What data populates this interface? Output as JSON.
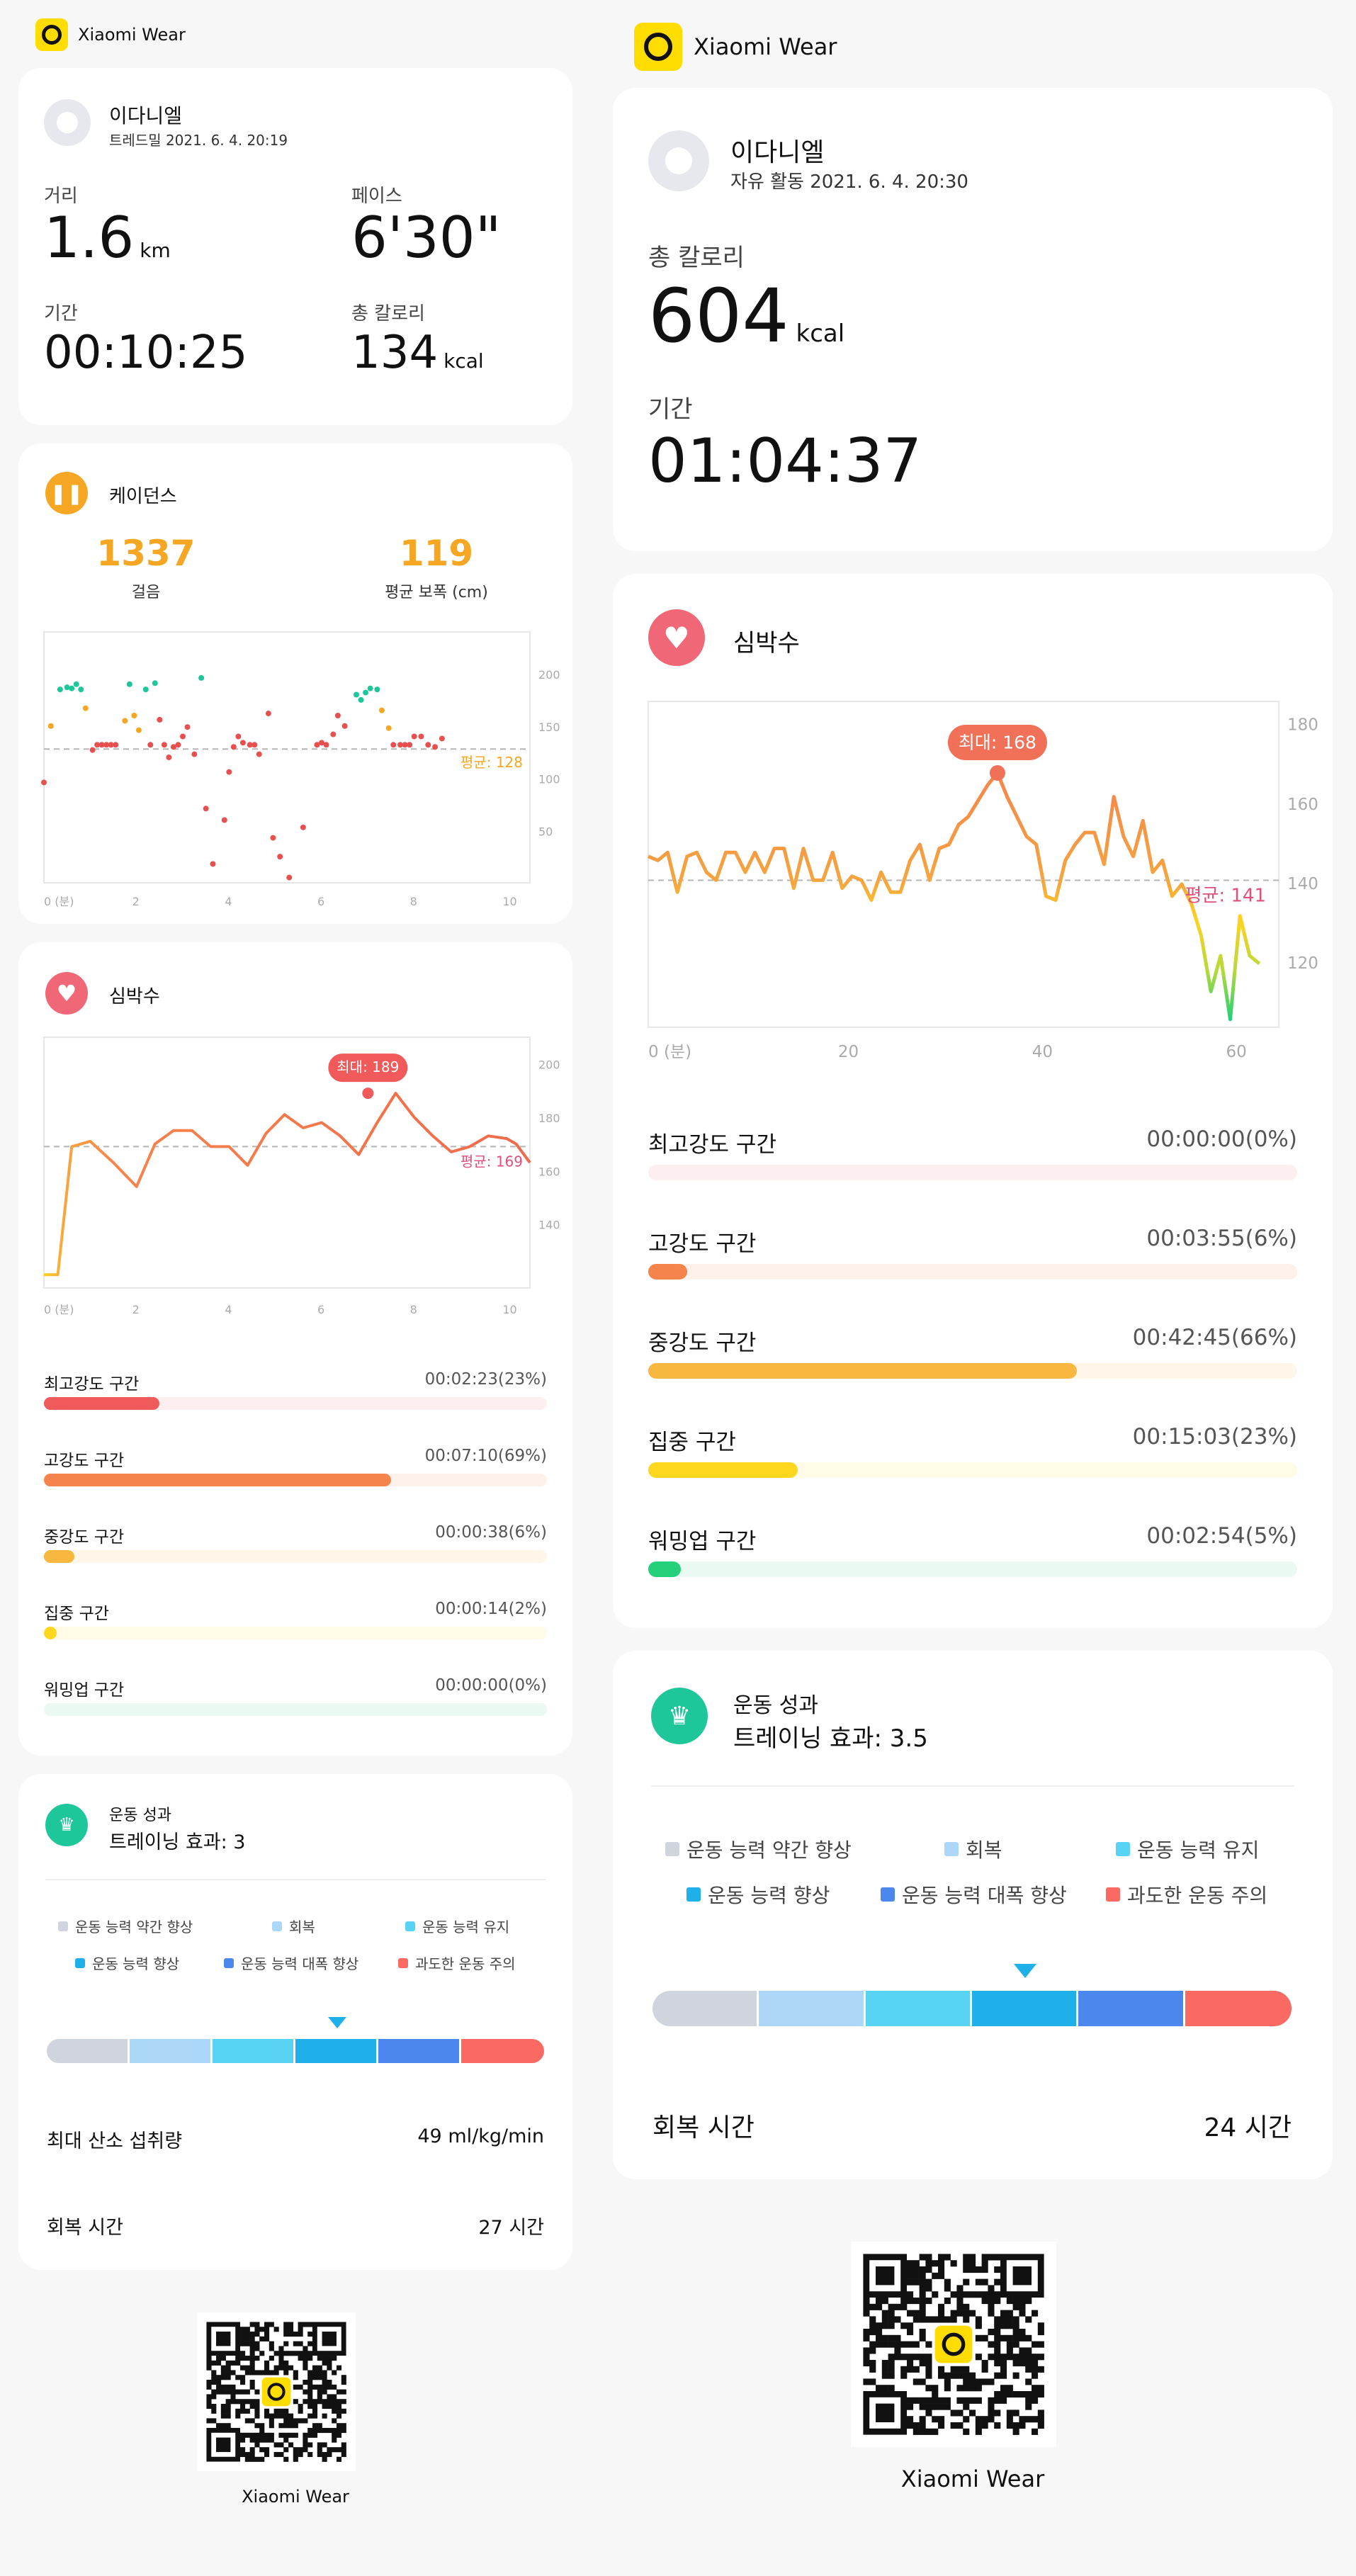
{
  "brand": {
    "name": "Xiaomi Wear"
  },
  "colors": {
    "zone_peak": "#f05a5a",
    "zone_anaerobic": "#f5844c",
    "zone_aerobic": "#f8b73e",
    "zone_fatburn": "#ffd71f",
    "zone_warmup": "#25d07a",
    "perf1": "#d0d5dd",
    "perf2": "#acd7f8",
    "perf3": "#58d3f4",
    "perf4": "#1fb0ea",
    "perf5": "#4b87ec",
    "perf6": "#fb6a62",
    "cadence": "#f5a623",
    "heart": "#f06878",
    "trophy": "#1ec79a"
  },
  "left": {
    "workout": {
      "user_name": "이다니엘",
      "subtitle": "트레드밀 2021. 6. 4. 20:19",
      "stats": [
        {
          "label": "거리",
          "value": "1.6",
          "unit": "km"
        },
        {
          "label": "페이스",
          "value": "6'30\"",
          "unit": ""
        },
        {
          "label": "기간",
          "value": "00:10:25",
          "unit": ""
        },
        {
          "label": "총 칼로리",
          "value": "134",
          "unit": "kcal"
        }
      ]
    },
    "cadence": {
      "title": "케이던스",
      "steps_value": "1337",
      "steps_label": "걸음",
      "stride_value": "119",
      "stride_label": "평균 보폭 (cm)",
      "avg_label": "평균: 128"
    },
    "heart": {
      "title": "심박수",
      "max_label": "최대: 189",
      "avg_label": "평균: 169"
    },
    "zones": [
      {
        "name": "최고강도 구간",
        "time": "00:02:23(23%)",
        "pct": 23,
        "color": "#f05a5a",
        "track": "#fdefef"
      },
      {
        "name": "고강도 구간",
        "time": "00:07:10(69%)",
        "pct": 69,
        "color": "#f5844c",
        "track": "#fef1ea"
      },
      {
        "name": "중강도 구간",
        "time": "00:00:38(6%)",
        "pct": 6,
        "color": "#f8b73e",
        "track": "#fef6e8"
      },
      {
        "name": "집중 구간",
        "time": "00:00:14(2%)",
        "pct": 2,
        "color": "#ffd71f",
        "track": "#fffbe6"
      },
      {
        "name": "워밍업 구간",
        "time": "00:00:00(0%)",
        "pct": 0,
        "color": "#25d07a",
        "track": "#eaf9f1"
      }
    ],
    "performance": {
      "title": "운동 성과",
      "effect": "트레이닝 효과: 3",
      "legend": [
        "운동 능력 약간 향상",
        "회복",
        "운동 능력 유지",
        "운동 능력 향상",
        "운동 능력 대폭 향상",
        "과도한 운동 주의"
      ],
      "level": 3.5,
      "vo2_label": "최대 산소 섭취량",
      "vo2_value": "49 ml/kg/min",
      "recovery_label": "회복 시간",
      "recovery_value": "27 시간"
    }
  },
  "right": {
    "workout": {
      "user_name": "이다니엘",
      "subtitle": "자유 활동 2021. 6. 4. 20:30",
      "calories_label": "총 칼로리",
      "calories_value": "604",
      "calories_unit": "kcal",
      "duration_label": "기간",
      "duration_value": "01:04:37"
    },
    "heart": {
      "title": "심박수",
      "max_label": "최대: 168",
      "avg_label": "평균: 141"
    },
    "zones": [
      {
        "name": "최고강도 구간",
        "time": "00:00:00(0%)",
        "pct": 0,
        "color": "#f05a5a",
        "track": "#fdefef"
      },
      {
        "name": "고강도 구간",
        "time": "00:03:55(6%)",
        "pct": 6,
        "color": "#f5844c",
        "track": "#fef1ea"
      },
      {
        "name": "중강도 구간",
        "time": "00:42:45(66%)",
        "pct": 66,
        "color": "#f8b73e",
        "track": "#fef6e8"
      },
      {
        "name": "집중 구간",
        "time": "00:15:03(23%)",
        "pct": 23,
        "color": "#ffd71f",
        "track": "#fffbe6"
      },
      {
        "name": "워밍업 구간",
        "time": "00:02:54(5%)",
        "pct": 5,
        "color": "#25d07a",
        "track": "#eaf9f1"
      }
    ],
    "performance": {
      "title": "운동 성과",
      "effect": "트레이닝 효과: 3.5",
      "legend": [
        "운동 능력 약간 향상",
        "회복",
        "운동 능력 유지",
        "운동 능력 향상",
        "운동 능력 대폭 향상",
        "과도한 운동 주의"
      ],
      "level": 3.5,
      "recovery_label": "회복 시간",
      "recovery_value": "24 시간"
    }
  },
  "chart_data": [
    {
      "type": "scatter",
      "title": "케이던스",
      "xlabel": "(분)",
      "x_ticks": [
        "0 (분)",
        "2",
        "4",
        "6",
        "8",
        "10"
      ],
      "y_ticks": [
        "200",
        "150",
        "100",
        "50"
      ],
      "xlim": [
        0,
        10.5
      ],
      "ylim": [
        0,
        240
      ],
      "average": 128,
      "series": [
        {
          "values": [
            [
              0,
              96
            ],
            [
              0.15,
              150
            ],
            [
              0.35,
              185
            ],
            [
              0.5,
              187
            ],
            [
              0.6,
              186
            ],
            [
              0.7,
              190
            ],
            [
              0.8,
              185
            ],
            [
              0.9,
              167
            ],
            [
              1.05,
              127
            ],
            [
              1.15,
              132
            ],
            [
              1.25,
              132
            ],
            [
              1.35,
              132
            ],
            [
              1.45,
              132
            ],
            [
              1.55,
              132
            ],
            [
              1.75,
              155
            ],
            [
              1.85,
              190
            ],
            [
              1.95,
              160
            ],
            [
              2.05,
              146
            ],
            [
              2.2,
              185
            ],
            [
              2.3,
              132
            ],
            [
              2.4,
              191
            ],
            [
              2.5,
              156
            ],
            [
              2.6,
              132
            ],
            [
              2.7,
              120
            ],
            [
              2.8,
              130
            ],
            [
              2.9,
              132
            ],
            [
              3.0,
              140
            ],
            [
              3.1,
              149
            ],
            [
              3.25,
              123
            ],
            [
              3.4,
              196
            ],
            [
              3.5,
              71
            ],
            [
              3.65,
              18
            ],
            [
              3.9,
              60
            ],
            [
              4.0,
              106
            ],
            [
              4.1,
              130
            ],
            [
              4.2,
              140
            ],
            [
              4.3,
              134
            ],
            [
              4.45,
              132
            ],
            [
              4.55,
              132
            ],
            [
              4.65,
              123
            ],
            [
              4.85,
              162
            ],
            [
              4.95,
              43
            ],
            [
              5.1,
              25
            ],
            [
              5.3,
              5
            ],
            [
              5.6,
              53
            ],
            [
              5.9,
              132
            ],
            [
              6.0,
              134
            ],
            [
              6.1,
              132
            ],
            [
              6.25,
              142
            ],
            [
              6.35,
              160
            ],
            [
              6.5,
              150
            ],
            [
              6.75,
              180
            ],
            [
              6.85,
              175
            ],
            [
              6.95,
              182
            ],
            [
              7.05,
              186
            ],
            [
              7.2,
              185
            ],
            [
              7.3,
              165
            ],
            [
              7.45,
              148
            ],
            [
              7.55,
              132
            ],
            [
              7.7,
              132
            ],
            [
              7.8,
              132
            ],
            [
              7.9,
              132
            ],
            [
              8.0,
              140
            ],
            [
              8.15,
              140
            ],
            [
              8.3,
              132
            ],
            [
              8.45,
              130
            ],
            [
              8.6,
              138
            ]
          ]
        }
      ]
    },
    {
      "type": "line",
      "title": "심박수",
      "xlabel": "(분)",
      "x_ticks": [
        "0 (분)",
        "2",
        "4",
        "6",
        "8",
        "10"
      ],
      "y_ticks": [
        "200",
        "180",
        "160",
        "140"
      ],
      "xlim": [
        0,
        10.5
      ],
      "ylim": [
        116,
        210
      ],
      "average": 169,
      "max_point": [
        7,
        189
      ],
      "series": [
        {
          "values": [
            [
              0,
              121
            ],
            [
              0.3,
              121
            ],
            [
              0.6,
              169
            ],
            [
              1.0,
              171
            ],
            [
              1.5,
              163
            ],
            [
              2.0,
              154
            ],
            [
              2.4,
              170
            ],
            [
              2.8,
              175
            ],
            [
              3.2,
              175
            ],
            [
              3.6,
              169
            ],
            [
              4.0,
              169
            ],
            [
              4.4,
              162
            ],
            [
              4.8,
              174
            ],
            [
              5.2,
              181
            ],
            [
              5.6,
              176
            ],
            [
              6.0,
              178
            ],
            [
              6.4,
              173
            ],
            [
              6.8,
              166
            ],
            [
              7.2,
              178
            ],
            [
              7.6,
              189
            ],
            [
              8.0,
              180
            ],
            [
              8.4,
              173
            ],
            [
              8.8,
              167
            ],
            [
              9.2,
              169
            ],
            [
              9.6,
              173
            ],
            [
              10.0,
              172
            ],
            [
              10.2,
              170
            ],
            [
              10.5,
              163
            ]
          ]
        }
      ]
    },
    {
      "type": "line",
      "title": "심박수",
      "xlabel": "(분)",
      "x_ticks": [
        "0 (분)",
        "20",
        "40",
        "60"
      ],
      "y_ticks": [
        "180",
        "160",
        "140",
        "120"
      ],
      "xlim": [
        0,
        65
      ],
      "ylim": [
        104,
        186
      ],
      "average": 141,
      "max_point": [
        36,
        168
      ],
      "series": [
        {
          "values": [
            [
              0,
              147
            ],
            [
              1,
              146
            ],
            [
              2,
              148
            ],
            [
              3,
              138
            ],
            [
              4,
              147
            ],
            [
              5,
              148
            ],
            [
              6,
              143
            ],
            [
              7,
              141
            ],
            [
              8,
              148
            ],
            [
              9,
              148
            ],
            [
              10,
              143
            ],
            [
              11,
              148
            ],
            [
              12,
              143
            ],
            [
              13,
              149
            ],
            [
              14,
              149
            ],
            [
              15,
              139
            ],
            [
              16,
              149
            ],
            [
              17,
              141
            ],
            [
              18,
              141
            ],
            [
              19,
              148
            ],
            [
              20,
              139
            ],
            [
              21,
              142
            ],
            [
              22,
              141
            ],
            [
              23,
              136
            ],
            [
              24,
              143
            ],
            [
              25,
              138
            ],
            [
              26,
              138
            ],
            [
              27,
              146
            ],
            [
              28,
              150
            ],
            [
              29,
              141
            ],
            [
              30,
              149
            ],
            [
              31,
              150
            ],
            [
              32,
              155
            ],
            [
              33,
              157
            ],
            [
              34,
              161
            ],
            [
              35,
              165
            ],
            [
              36,
              168
            ],
            [
              37,
              162
            ],
            [
              38,
              157
            ],
            [
              39,
              152
            ],
            [
              40,
              150
            ],
            [
              41,
              137
            ],
            [
              42,
              136
            ],
            [
              43,
              146
            ],
            [
              44,
              150
            ],
            [
              45,
              153
            ],
            [
              46,
              153
            ],
            [
              47,
              145
            ],
            [
              48,
              162
            ],
            [
              49,
              152
            ],
            [
              50,
              147
            ],
            [
              51,
              156
            ],
            [
              52,
              143
            ],
            [
              53,
              146
            ],
            [
              54,
              137
            ],
            [
              55,
              140
            ],
            [
              56,
              135
            ],
            [
              57,
              127
            ],
            [
              58,
              113
            ],
            [
              59,
              122
            ],
            [
              60,
              106
            ],
            [
              61,
              132
            ],
            [
              62,
              122
            ],
            [
              63,
              120
            ]
          ]
        }
      ]
    }
  ]
}
